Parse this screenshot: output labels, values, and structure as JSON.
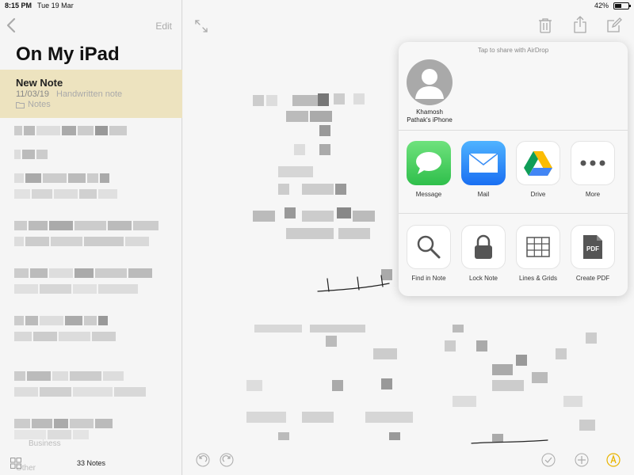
{
  "status_bar": {
    "time": "8:15 PM",
    "date": "Tue 19 Mar",
    "battery": "42%",
    "battery_level": 0.42
  },
  "sidebar": {
    "edit_label": "Edit",
    "title": "On My iPad",
    "selected_note": {
      "title": "New Note",
      "date": "11/03/19",
      "preview": "Handwritten note",
      "folder": "Notes"
    },
    "faded_labels": [
      "Business",
      "Other"
    ],
    "notes_count": "33 Notes"
  },
  "share_sheet": {
    "airdrop_hint": "Tap to share with AirDrop",
    "airdrop_device": {
      "line1": "Khamosh",
      "line2": "Pathak's iPhone"
    },
    "apps": [
      {
        "label": "Message",
        "icon": "messages-icon",
        "color": "#35c759"
      },
      {
        "label": "Mail",
        "icon": "mail-icon",
        "color": "#1a82fb"
      },
      {
        "label": "Drive",
        "icon": "google-drive-icon"
      },
      {
        "label": "More",
        "icon": "more-icon"
      }
    ],
    "actions": [
      {
        "label": "Find in Note",
        "icon": "magnifier-icon"
      },
      {
        "label": "Lock Note",
        "icon": "lock-icon"
      },
      {
        "label": "Lines & Grids",
        "icon": "grid-icon"
      },
      {
        "label": "Create PDF",
        "icon": "pdf-icon",
        "badge": "PDF"
      }
    ]
  }
}
